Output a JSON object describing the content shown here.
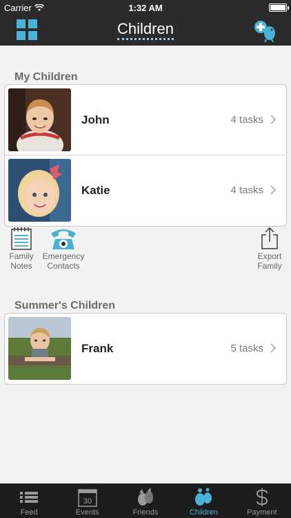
{
  "status_bar": {
    "carrier": "Carrier",
    "time": "1:32 AM",
    "battery_level": 1.0
  },
  "nav": {
    "title": "Children",
    "left_icon": "grid-icon",
    "right_icon": "add-child-icon"
  },
  "my_children": {
    "header": "My Children",
    "items": [
      {
        "name": "John",
        "tasks": "4 tasks"
      },
      {
        "name": "Katie",
        "tasks": "4 tasks"
      }
    ]
  },
  "actions": [
    {
      "line1": "Family",
      "line2": "Notes",
      "icon": "notepad-icon"
    },
    {
      "line1": "Emergency",
      "line2": "Contacts",
      "icon": "phone-icon"
    },
    {
      "line1": "Export",
      "line2": "Family",
      "icon": "share-icon"
    }
  ],
  "summers_children": {
    "header": "Summer's Children",
    "items": [
      {
        "name": "Frank",
        "tasks": "5 tasks"
      }
    ]
  },
  "tabs": [
    {
      "label": "Feed",
      "icon": "list-icon"
    },
    {
      "label": "Events",
      "icon": "calendar-icon",
      "calendar_day": "30"
    },
    {
      "label": "Friends",
      "icon": "friends-icon"
    },
    {
      "label": "Children",
      "icon": "children-icon",
      "active": true
    },
    {
      "label": "Payment",
      "icon": "dollar-icon"
    }
  ],
  "colors": {
    "accent": "#4ab2d6",
    "bar": "#2b2b2b",
    "tabbar": "#1c1c1c",
    "background": "#f2f2f2"
  }
}
